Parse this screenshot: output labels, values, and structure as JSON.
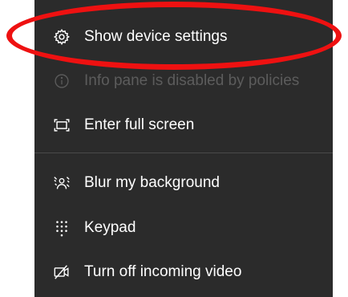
{
  "menu": {
    "items": [
      {
        "label": "Show device settings",
        "icon": "gear-icon",
        "enabled": true
      },
      {
        "label": "Info pane is disabled by policies",
        "icon": "info-icon",
        "enabled": false
      },
      {
        "label": "Enter full screen",
        "icon": "fullscreen-icon",
        "enabled": true
      },
      {
        "label": "Blur my background",
        "icon": "blur-background-icon",
        "enabled": true
      },
      {
        "label": "Keypad",
        "icon": "keypad-icon",
        "enabled": true
      },
      {
        "label": "Turn off incoming video",
        "icon": "video-off-icon",
        "enabled": true
      }
    ]
  },
  "colors": {
    "menu_background": "#2b2b2b",
    "text": "#ffffff",
    "disabled_text": "#5c5c5c",
    "highlight": "#ee1111"
  }
}
